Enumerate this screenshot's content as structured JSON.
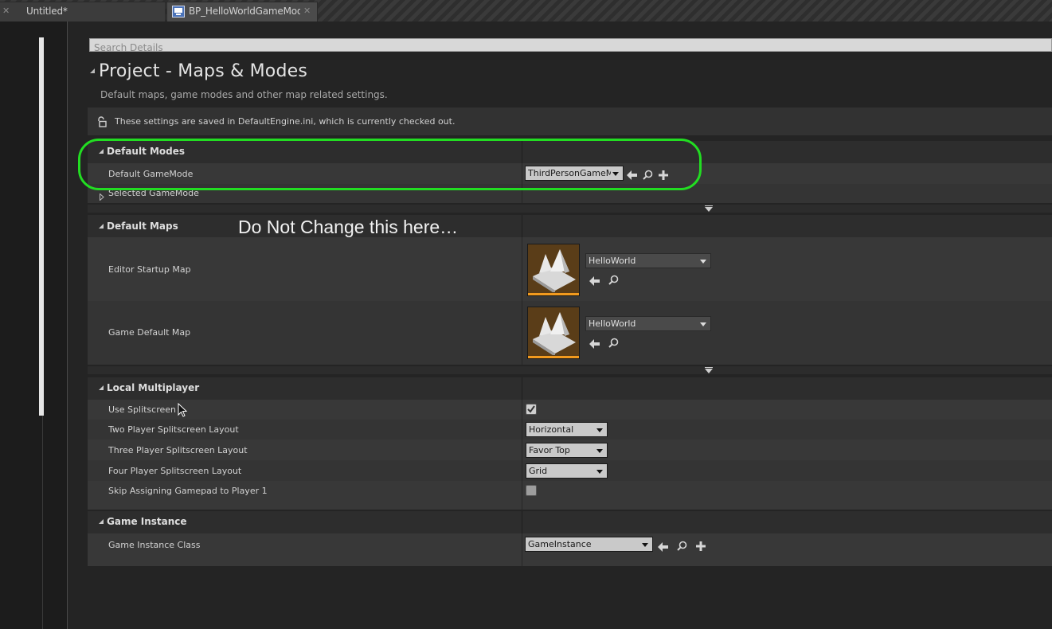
{
  "tabs": [
    {
      "label": "Untitled*",
      "active": false
    },
    {
      "label": "BP_HelloWorldGameMode",
      "active": true
    }
  ],
  "search": {
    "placeholder": "Search Details"
  },
  "page": {
    "title": "Project - Maps & Modes",
    "description": "Default maps, game modes and other map related settings.",
    "notice": "These settings are saved in DefaultEngine.ini, which is currently checked out."
  },
  "default_modes": {
    "header": "Default Modes",
    "default_gamemode_label": "Default GameMode",
    "default_gamemode_value": "ThirdPersonGameMode",
    "selected_gamemode_label": "Selected GameMode"
  },
  "default_maps": {
    "header": "Default Maps",
    "editor_startup_label": "Editor Startup Map",
    "editor_startup_value": "HelloWorld",
    "game_default_label": "Game Default Map",
    "game_default_value": "HelloWorld"
  },
  "annotation": "Do Not Change this here…",
  "local_multiplayer": {
    "header": "Local Multiplayer",
    "use_splitscreen_label": "Use Splitscreen",
    "use_splitscreen_checked": true,
    "two_player_label": "Two Player Splitscreen Layout",
    "two_player_value": "Horizontal",
    "three_player_label": "Three Player Splitscreen Layout",
    "three_player_value": "Favor Top",
    "four_player_label": "Four Player Splitscreen Layout",
    "four_player_value": "Grid",
    "skip_gamepad_label": "Skip Assigning Gamepad to Player 1",
    "skip_gamepad_checked": false
  },
  "game_instance": {
    "header": "Game Instance",
    "class_label": "Game Instance Class",
    "class_value": "GameInstance"
  },
  "colors": {
    "highlight": "#22dd22",
    "asset_thumb_accent": "#f29a1e"
  },
  "icons": [
    "close-icon",
    "blueprint-icon",
    "lock-icon",
    "browse-back-icon",
    "find-in-browser-icon",
    "add-icon",
    "checkmark-icon",
    "world-map-icon"
  ]
}
